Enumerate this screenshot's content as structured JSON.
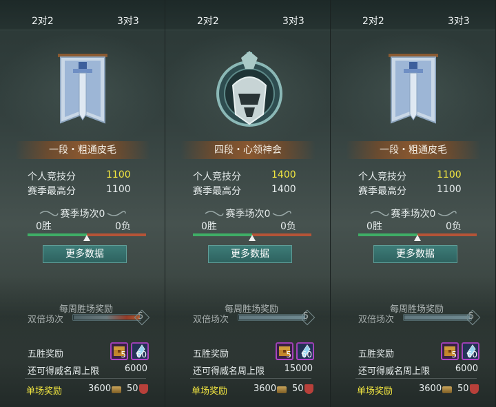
{
  "panels": [
    {
      "tabs": [
        "2对2",
        "3对3"
      ],
      "emblem": "blue-sword-banner-icon",
      "rank_title": "一段・粗通皮毛",
      "personal_score_label": "个人竞技分",
      "personal_score": "1100",
      "season_high_label": "赛季最高分",
      "season_high": "1100",
      "season_matches": "赛季场次0",
      "wins": "0胜",
      "losses": "0负",
      "win_ratio": 0.5,
      "more_data": "更多数据",
      "weekly_reward_title": "每周胜场奖励",
      "double_label": "双倍场次",
      "double_count": "5",
      "double_fill": 1.0,
      "double_burn": true,
      "five_win_label": "五胜奖励",
      "five_win_items": [
        "5",
        "60"
      ],
      "reputation_label": "还可得威名周上限",
      "reputation_value": "6000",
      "single_reward_label": "单场奖励",
      "single_coin": "3600",
      "single_honor": "50"
    },
    {
      "tabs": [
        "2对2",
        "3对3"
      ],
      "emblem": "silver-helmet-rank-icon",
      "rank_title": "四段・心领神会",
      "personal_score_label": "个人竞技分",
      "personal_score": "1400",
      "season_high_label": "赛季最高分",
      "season_high": "1400",
      "season_matches": "赛季场次0",
      "wins": "0胜",
      "losses": "0负",
      "win_ratio": 0.5,
      "more_data": "更多数据",
      "weekly_reward_title": "每周胜场奖励",
      "double_label": "双倍场次",
      "double_count": "5",
      "double_fill": 1.0,
      "double_burn": false,
      "five_win_label": "五胜奖励",
      "five_win_items": [
        "5",
        "60"
      ],
      "reputation_label": "还可得威名周上限",
      "reputation_value": "15000",
      "single_reward_label": "单场奖励",
      "single_coin": "3600",
      "single_honor": "50"
    },
    {
      "tabs": [
        "2对2",
        "3对3"
      ],
      "emblem": "blue-sword-banner-icon",
      "rank_title": "一段・粗通皮毛",
      "personal_score_label": "个人竞技分",
      "personal_score": "1100",
      "season_high_label": "赛季最高分",
      "season_high": "1100",
      "season_matches": "赛季场次0",
      "wins": "0胜",
      "losses": "0负",
      "win_ratio": 0.5,
      "more_data": "更多数据",
      "weekly_reward_title": "每周胜场奖励",
      "double_label": "双倍场次",
      "double_count": "5",
      "double_fill": 1.0,
      "double_burn": false,
      "five_win_label": "五胜奖励",
      "five_win_items": [
        "5",
        "60"
      ],
      "reputation_label": "还可得威名周上限",
      "reputation_value": "6000",
      "single_reward_label": "单场奖励",
      "single_coin": "3600",
      "single_honor": "50"
    }
  ],
  "colors": {
    "score_highlight": "#f2e640",
    "win_bar": "#3fae66",
    "loss_bar": "#b55437",
    "button": "#3d7c78"
  }
}
